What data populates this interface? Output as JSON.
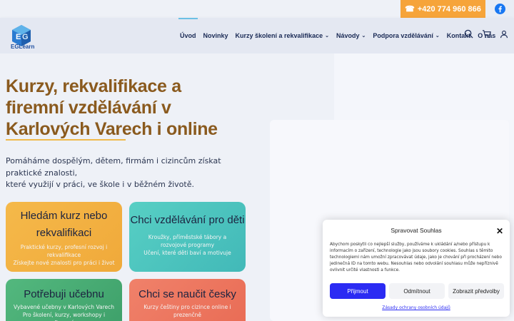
{
  "topbar": {
    "phone": "+420 774 960 866",
    "phone_icon": "phone-icon",
    "social_icon": "facebook-icon",
    "colors": {
      "phone_bg": "#f6a43a",
      "facebook": "#1877f2"
    }
  },
  "header": {
    "logo_text": "EGLearn",
    "nav": [
      {
        "label": "Úvod",
        "active": true,
        "dropdown": false
      },
      {
        "label": "Novinky",
        "dropdown": false
      },
      {
        "label": "Kurzy školení a rekvalifikace",
        "dropdown": true
      },
      {
        "label": "Návody",
        "dropdown": true
      },
      {
        "label": "Podpora vzdělávání",
        "dropdown": true
      },
      {
        "label": "Kontakt",
        "dropdown": false
      },
      {
        "label": "O nás",
        "dropdown": false
      }
    ],
    "icons": [
      "search-icon",
      "cart-icon",
      "user-icon"
    ]
  },
  "hero": {
    "title": "Kurzy, rekvalifikace a firemní vzdělávání v Karlových Varech i online",
    "subtitle_line1": "Pomáháme dospělým, dětem, firmám i cizincům získat praktické znalosti,",
    "subtitle_line2": "které využijí v práci, ve škole i v běžném životě.",
    "title_color": "#8a5a1e"
  },
  "cards": [
    {
      "title": "Hledám kurz nebo rekvalifikaci",
      "text1": "Praktické kurzy, profesní rozvoj i rekvalifikace",
      "text2": "Získejte nové znalosti pro práci i život",
      "color": "#f5b94a"
    },
    {
      "title": "Chci vzdělávání pro děti",
      "text1": "Kroužky, příměstské tábory a rozvojové programy",
      "text2": "Učení, které děti baví a motivuje",
      "color": "#57cfc4"
    },
    {
      "title": "Potřebuji učebnu",
      "text1": "Vybavené učebny v Karlových Varech",
      "text2": "Pro školení, kurzy, workshopy i firemní",
      "color": "#53b87e"
    },
    {
      "title": "Chci se naučit česky",
      "text1": "Kurzy češtiny pro cizince online i",
      "text2": "prezenčně",
      "color": "#f0816a"
    }
  ],
  "cookie": {
    "title": "Spravovat Souhlas",
    "text": "Abychom poskytli co nejlepší služby, používáme k ukládání a/nebo přístupu k informacím o zařízení, technologie jako jsou soubory cookies. Souhlas s těmito technologiemi nám umožní zpracovávat údaje, jako je chování při procházení nebo jedinečná ID na tomto webu. Nesouhlas nebo odvolání souhlasu může nepříznivě ovlivnit určité vlastnosti a funkce.",
    "accept": "Přijmout",
    "deny": "Odmítnout",
    "preferences": "Zobrazit předvolby",
    "link": "Zásady ochrany osobních údajů",
    "accent": "#2b2bf3"
  }
}
